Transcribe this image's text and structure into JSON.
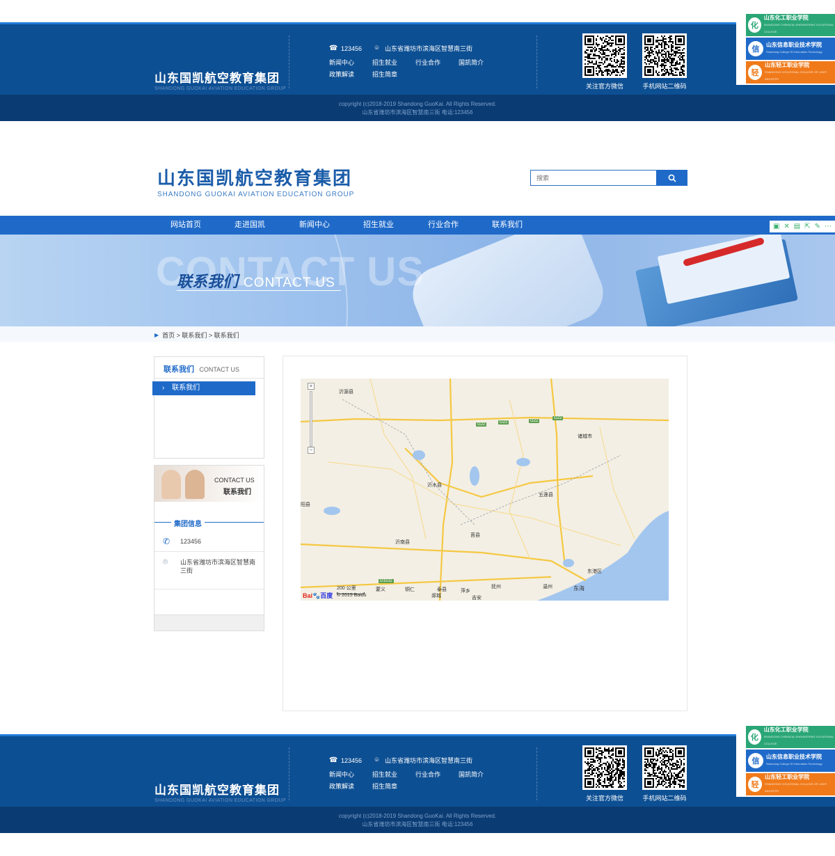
{
  "footer": {
    "logo_cn": "山东国凯航空教育集团",
    "logo_en": "SHANDONG GUOKAI AVIATION EDUCATION GROUP",
    "phone": "123456",
    "address": "山东省潍坊市滨海区智慧南三街",
    "nav": [
      "新闻中心",
      "招生就业",
      "行业合作",
      "国凯简介",
      "政策解读",
      "招生简章"
    ],
    "qr_wechat_label": "关注官方微信",
    "qr_mobile_label": "手机网站二维码",
    "copyright": "copyright (c)2018-2019 Shandong GuoKai. All Rights Reserved.",
    "address_line": "山东省潍坊市滨海区智慧南三街  电话:123456",
    "schools": [
      {
        "name": "山东化工职业学院",
        "sub": "SHANDONG CHEMICAL ENGINEERING VOCATIONAL COLLEGE",
        "color": "#2aa676",
        "badge": "化"
      },
      {
        "name": "山东信息职业技术学院",
        "sub": "Shandong College Of Information Technology",
        "color": "#1f6ac9",
        "badge": "信"
      },
      {
        "name": "山东轻工职业学院",
        "sub": "SHANDONG VOCATIONAL COLLEGE OF LIGHT INDUSTRY",
        "color": "#f07a1a",
        "badge": "轻"
      }
    ]
  },
  "header": {
    "logo_cn": "山东国凯航空教育集团",
    "logo_en": "SHANDONG GUOKAI AVIATION EDUCATION GROUP",
    "search_placeholder": "搜索"
  },
  "nav": {
    "items": [
      "网站首页",
      "走进国凯",
      "新闻中心",
      "招生就业",
      "行业合作",
      "联系我们"
    ],
    "tools": [
      "bookmark-icon",
      "fullscreen-icon",
      "reader-icon",
      "share-icon",
      "edit-icon",
      "more-icon"
    ]
  },
  "banner": {
    "ghost_text": "CONTACT US",
    "title_cn": "联系我们",
    "title_en": "CONTACT US"
  },
  "breadcrumb": {
    "text": "首页 > 联系我们 > 联系我们"
  },
  "sidebar": {
    "title_cn": "联系我们",
    "title_en": "CONTACT US",
    "current": "联系我们"
  },
  "info": {
    "pic_en": "CONTACT US",
    "pic_cn": "联系我们",
    "section_label": "集团信息",
    "phone": "123456",
    "address": "山东省潍坊市滨海区智慧南三街"
  },
  "map": {
    "labels": [
      "沂源县",
      "诸城市",
      "沂水县",
      "五莲县",
      "阳县",
      "莒县",
      "沂南县",
      "东港区",
      "东海",
      "蒙义",
      "铜仁",
      "泰县",
      "郯城",
      "萍乡",
      "吉安",
      "抚州",
      "温州"
    ],
    "shields": [
      "G22",
      "G22",
      "G22",
      "G22",
      "G1511"
    ],
    "scale": "200 公里",
    "logo_bai": "Bai",
    "logo_du": "du",
    "logo_cn": "百度",
    "copyright": "© 2015 Baidu"
  },
  "colors": {
    "footer_top": "#0d4f93",
    "footer_bottom": "#0a3b73",
    "nav": "#1f6ac9",
    "brand": "#1a5ca9"
  }
}
